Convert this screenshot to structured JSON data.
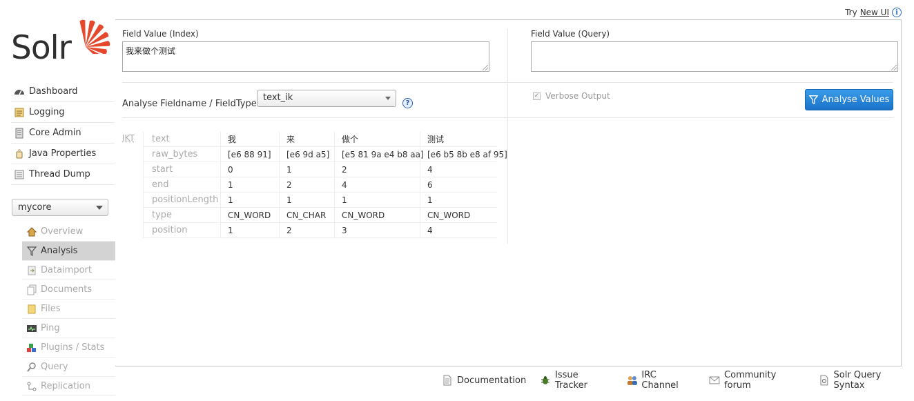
{
  "top": {
    "try_text": "Try",
    "new_ui": "New UI"
  },
  "logo": {
    "text": "Solr"
  },
  "nav": [
    {
      "label": "Dashboard",
      "icon": "dashboard-icon"
    },
    {
      "label": "Logging",
      "icon": "logging-icon"
    },
    {
      "label": "Core Admin",
      "icon": "core-admin-icon"
    },
    {
      "label": "Java Properties",
      "icon": "java-icon"
    },
    {
      "label": "Thread Dump",
      "icon": "thread-dump-icon"
    }
  ],
  "core_selector": {
    "value": "mycore"
  },
  "core_nav": [
    {
      "label": "Overview"
    },
    {
      "label": "Analysis"
    },
    {
      "label": "Dataimport"
    },
    {
      "label": "Documents"
    },
    {
      "label": "Files"
    },
    {
      "label": "Ping"
    },
    {
      "label": "Plugins / Stats"
    },
    {
      "label": "Query"
    },
    {
      "label": "Replication"
    }
  ],
  "analysis": {
    "index_label": "Field Value (Index)",
    "index_value": "我来做个测试",
    "query_label": "Field Value (Query)",
    "query_value": "",
    "fieldtype_label": "Analyse Fieldname / FieldType:",
    "fieldtype_value": "text_ik",
    "help": "?",
    "verbose_label": "Verbose Output",
    "analyse_button": "Analyse Values"
  },
  "tokens": {
    "analyzer": "IKT",
    "properties": [
      "text",
      "raw_bytes",
      "start",
      "end",
      "positionLength",
      "type",
      "position"
    ],
    "columns": [
      {
        "text": "我",
        "raw_bytes": "[e6 88 91]",
        "start": "0",
        "end": "1",
        "positionLength": "1",
        "type": "CN_WORD",
        "position": "1"
      },
      {
        "text": "来",
        "raw_bytes": "[e6 9d a5]",
        "start": "1",
        "end": "2",
        "positionLength": "1",
        "type": "CN_CHAR",
        "position": "2"
      },
      {
        "text": "做个",
        "raw_bytes": "[e5 81 9a e4 b8 aa]",
        "start": "2",
        "end": "4",
        "positionLength": "1",
        "type": "CN_WORD",
        "position": "3"
      },
      {
        "text": "测试",
        "raw_bytes": "[e6 b5 8b e8 af 95]",
        "start": "4",
        "end": "6",
        "positionLength": "1",
        "type": "CN_WORD",
        "position": "4"
      }
    ]
  },
  "footer": [
    {
      "label": "Documentation",
      "icon": "document-icon"
    },
    {
      "label": "Issue Tracker",
      "icon": "bug-icon"
    },
    {
      "label": "IRC Channel",
      "icon": "users-icon"
    },
    {
      "label": "Community forum",
      "icon": "mail-icon"
    },
    {
      "label": "Solr Query Syntax",
      "icon": "query-syntax-icon"
    }
  ]
}
